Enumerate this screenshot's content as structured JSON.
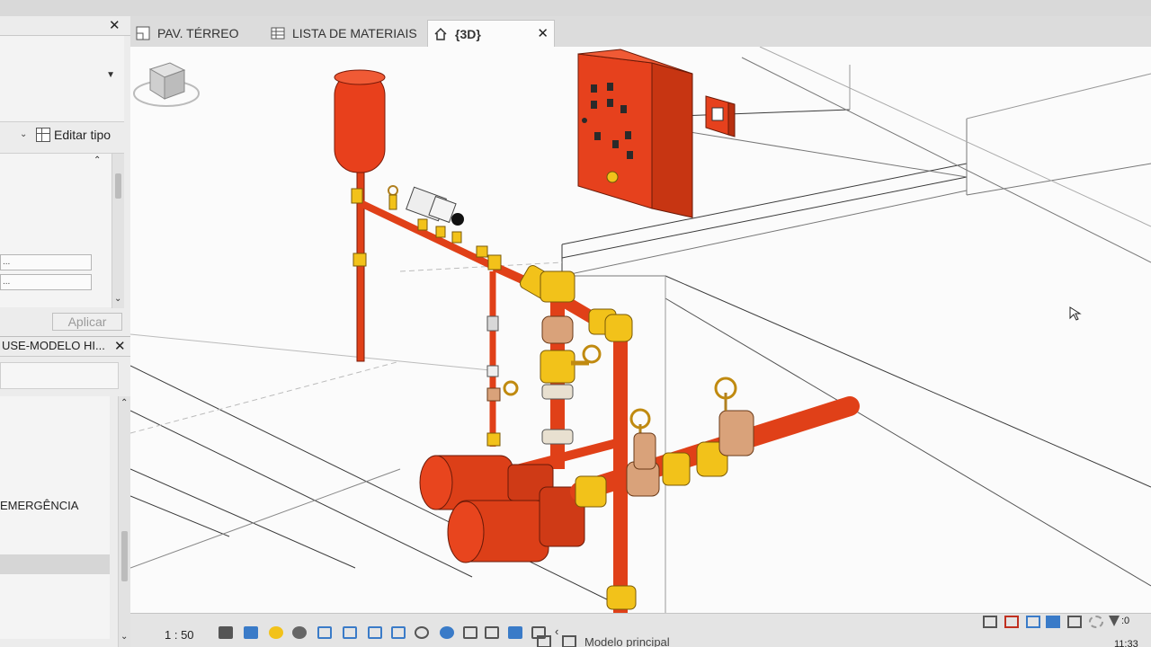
{
  "properties_panel": {
    "edit_type_label": "Editar tipo",
    "field_1": "...",
    "field_2": "...",
    "apply_label": "Aplicar"
  },
  "project_browser": {
    "title": "USE-MODELO HI...",
    "tree_item": "EMERGÊNCIA"
  },
  "tabs": [
    {
      "label": "PAV. TÉRREO",
      "icon": "floor-plan-icon"
    },
    {
      "label": "LISTA DE MATERIAIS",
      "icon": "schedule-icon"
    },
    {
      "label": "{3D}",
      "icon": "home-icon",
      "active": true
    }
  ],
  "view_controls": {
    "scale": "1 : 50",
    "icons": [
      "detail-level-icon",
      "visual-style-icon",
      "sun-path-icon",
      "shadows-icon",
      "render-icon",
      "crop-view-icon",
      "show-crop-icon",
      "temporary-hide-icon",
      "reveal-hidden-icon",
      "worksharing-icon",
      "lock-view-icon",
      "analytical-model-icon",
      "highlight-displacement-icon",
      "reveal-constraints-icon",
      "collapse-icon"
    ]
  },
  "status_bar": {
    "model_label": "Modelo principal",
    "filter_count": ":0",
    "clock": "11:33"
  },
  "colors": {
    "pipe_red": "#e8401c",
    "fitting_yellow": "#f2c21a",
    "valve_bronze": "#d9a27a",
    "panel_red": "#e6411d",
    "viewport_bg": "#fbfbfb"
  }
}
